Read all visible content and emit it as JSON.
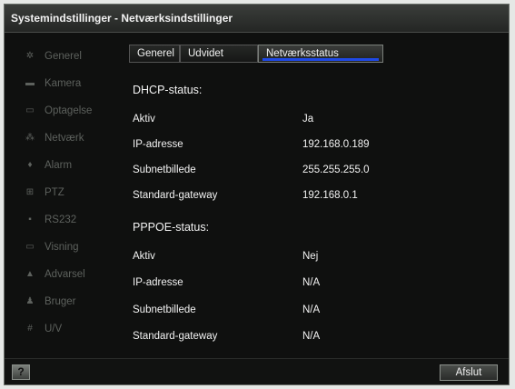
{
  "window": {
    "title": "Systemindstillinger - Netværksindstillinger"
  },
  "sidebar": {
    "items": [
      {
        "label": "Generel",
        "icon": "gear-icon"
      },
      {
        "label": "Kamera",
        "icon": "camera-icon"
      },
      {
        "label": "Optagelse",
        "icon": "record-icon"
      },
      {
        "label": "Netværk",
        "icon": "network-icon"
      },
      {
        "label": "Alarm",
        "icon": "alarm-icon"
      },
      {
        "label": "PTZ",
        "icon": "ptz-icon"
      },
      {
        "label": "RS232",
        "icon": "rs232-icon"
      },
      {
        "label": "Visning",
        "icon": "display-icon"
      },
      {
        "label": "Advarsel",
        "icon": "warning-icon"
      },
      {
        "label": "Bruger",
        "icon": "user-icon"
      },
      {
        "label": "U/V",
        "icon": "uv-icon"
      }
    ]
  },
  "tabs": [
    {
      "label": "Generel"
    },
    {
      "label": "Udvidet"
    },
    {
      "label": "Netværksstatus",
      "active": true
    }
  ],
  "dhcp": {
    "heading": "DHCP-status:",
    "rows": [
      {
        "label": "Aktiv",
        "value": "Ja"
      },
      {
        "label": "IP-adresse",
        "value": "192.168.0.189"
      },
      {
        "label": "Subnetbillede",
        "value": "255.255.255.0"
      },
      {
        "label": "Standard-gateway",
        "value": "192.168.0.1"
      }
    ]
  },
  "pppoe": {
    "heading": "PPPOE-status:",
    "rows": [
      {
        "label": "Aktiv",
        "value": "Nej"
      },
      {
        "label": "IP-adresse",
        "value": "N/A"
      },
      {
        "label": "Subnetbillede",
        "value": "N/A"
      },
      {
        "label": "Standard-gateway",
        "value": "N/A"
      }
    ]
  },
  "footer": {
    "help_label": "?",
    "exit_label": "Afslut"
  },
  "colors": {
    "accent": "#1f49e6",
    "background": "#0f100f",
    "inactive_text": "#5d615d",
    "text": "#f2f2f2"
  }
}
